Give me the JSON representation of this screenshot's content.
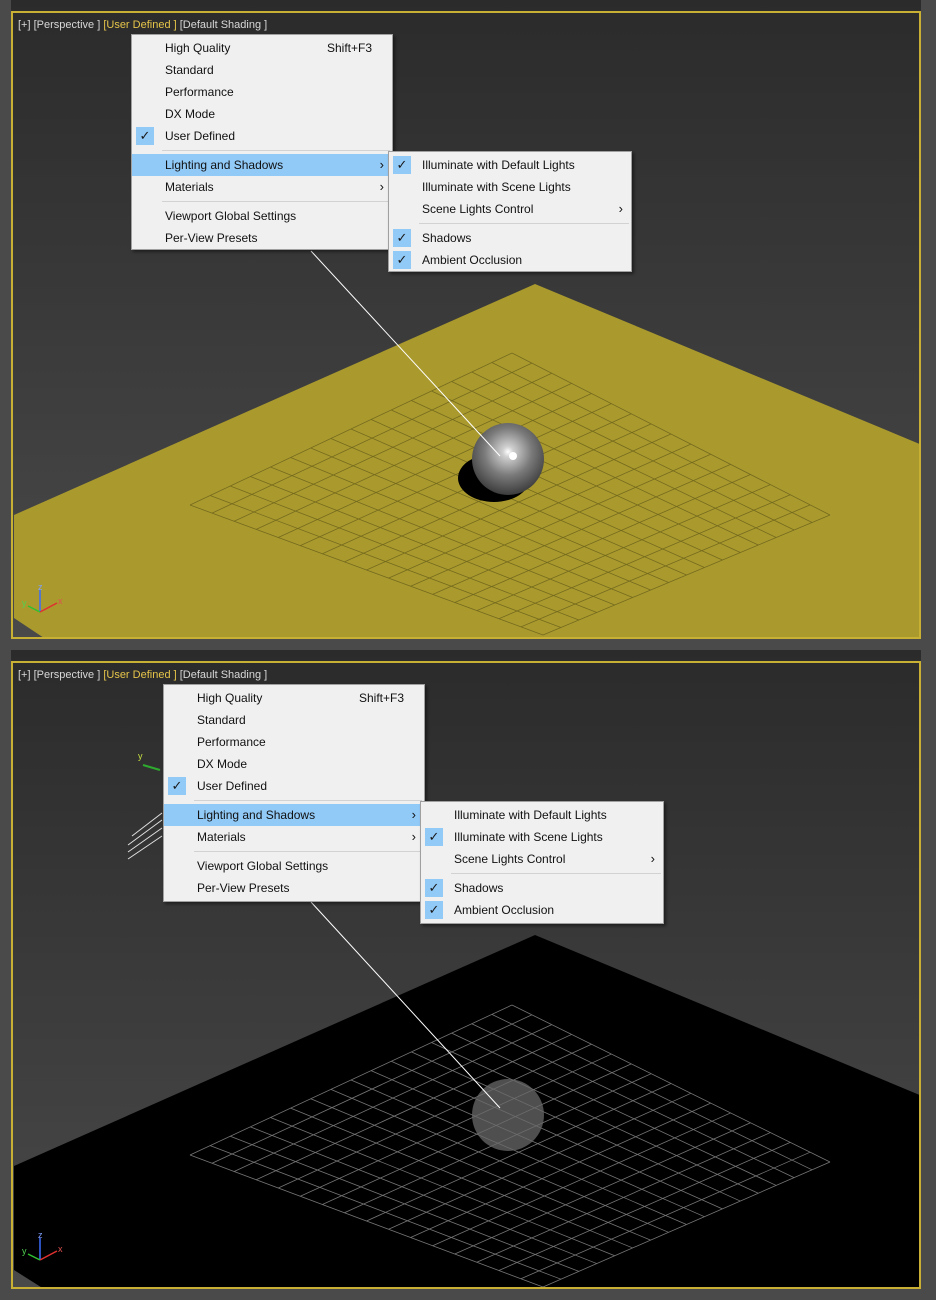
{
  "viewport_label": {
    "plus": "[+]",
    "view": "[Perspective ]",
    "mode": "[User Defined ]",
    "shading": "[Default Shading ]"
  },
  "main_menu": {
    "high_quality": "High Quality",
    "high_quality_shortcut": "Shift+F3",
    "standard": "Standard",
    "performance": "Performance",
    "dx_mode": "DX Mode",
    "user_defined": "User Defined",
    "lighting_and_shadows": "Lighting and Shadows",
    "materials": "Materials",
    "viewport_global_settings": "Viewport Global Settings",
    "per_view_presets": "Per-View Presets"
  },
  "submenu": {
    "illuminate_default": "Illuminate with Default Lights",
    "illuminate_scene": "Illuminate with Scene Lights",
    "scene_lights_control": "Scene Lights Control",
    "shadows": "Shadows",
    "ambient_occlusion": "Ambient Occlusion"
  },
  "glyphs": {
    "check": "✓",
    "arrow": "›"
  },
  "axes": {
    "x": "x",
    "y": "y",
    "z": "z"
  },
  "colors": {
    "viewport_border": "#c8b035",
    "menu_highlight": "#91c9f7",
    "ground_lit": "#aa9a2e",
    "ground_dark": "#000000"
  }
}
